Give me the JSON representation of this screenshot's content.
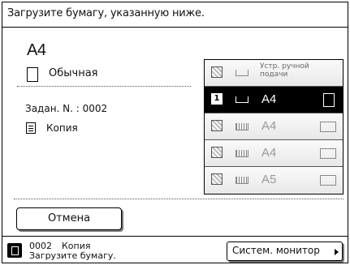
{
  "message": "Загрузите бумагу, указанную ниже.",
  "paper": {
    "size": "A4",
    "type": "Обычная",
    "type_icon": "paper-sheet-icon"
  },
  "job": {
    "number_label": "Задан. N.",
    "number": "0002",
    "mode_icon": "copy-document-icon",
    "mode": "Копия"
  },
  "trays": [
    {
      "id": "manual",
      "icon": "bypass-tray-icon",
      "label": "Устр. ручной подачи",
      "selected": false
    },
    {
      "id": "1",
      "num": "1",
      "icon": "drawer-1-icon",
      "label": "A4",
      "orientation": "portrait",
      "selected": true
    },
    {
      "id": "2",
      "num": "2",
      "icon": "drawer-2-icon",
      "label": "A4",
      "orientation": "landscape",
      "selected": false
    },
    {
      "id": "3",
      "num": "3",
      "icon": "drawer-3-icon",
      "label": "A4",
      "orientation": "landscape",
      "selected": false
    },
    {
      "id": "4",
      "num": "4",
      "icon": "drawer-4-icon",
      "label": "A5",
      "orientation": "landscape",
      "selected": false
    }
  ],
  "buttons": {
    "cancel": "Отмена",
    "system_monitor": "Систем. монитор"
  },
  "status_bar": {
    "icon": "document-status-icon",
    "job_number": "0002",
    "job_mode": "Копия",
    "message": "Загрузите бумагу."
  }
}
